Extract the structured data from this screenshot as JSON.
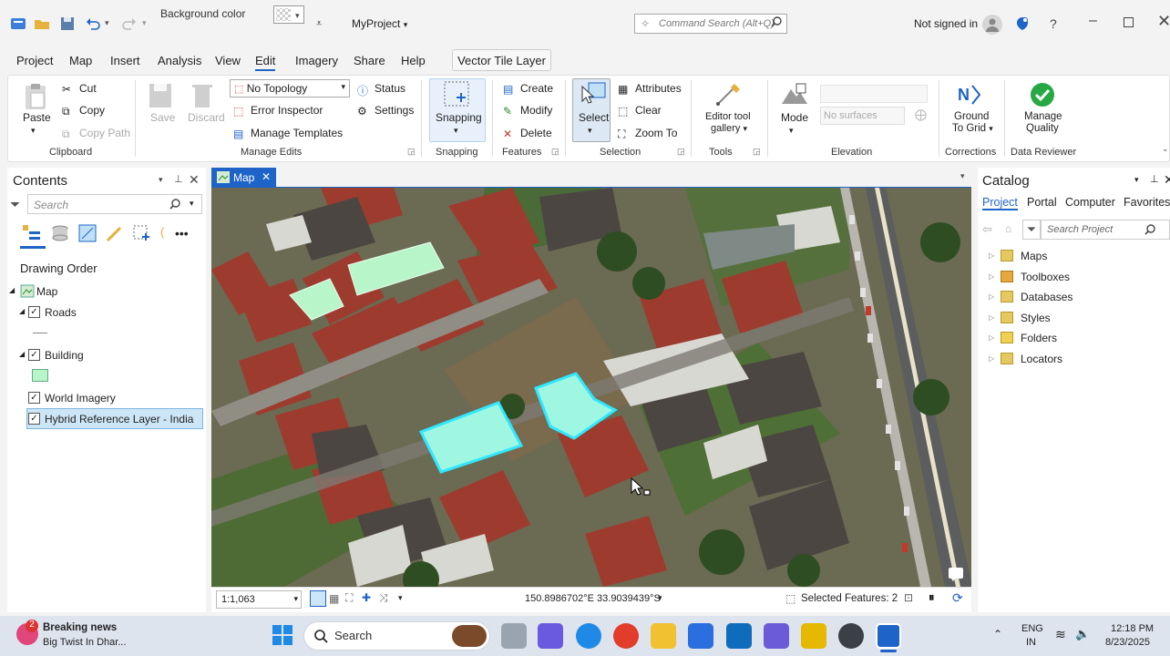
{
  "titlebar": {
    "background_color_label": "Background color",
    "project_name": "MyProject",
    "command_search_placeholder": "Command Search (Alt+Q)",
    "not_signed_in": "Not signed in"
  },
  "menu": [
    "Project",
    "Map",
    "Insert",
    "Analysis",
    "View",
    "Edit",
    "Imagery",
    "Share",
    "Help"
  ],
  "contextual_tab": "Vector Tile Layer",
  "ribbon": {
    "clipboard": {
      "paste": "Paste",
      "cut": "Cut",
      "copy": "Copy",
      "copy_path": "Copy Path",
      "group": "Clipboard"
    },
    "manage_edits": {
      "save": "Save",
      "discard": "Discard",
      "topology": "No Topology",
      "status": "Status",
      "error_inspector": "Error Inspector",
      "settings": "Settings",
      "manage_templates": "Manage Templates",
      "group": "Manage Edits"
    },
    "snapping": {
      "snapping": "Snapping",
      "group": "Snapping"
    },
    "features": {
      "create": "Create",
      "modify": "Modify",
      "delete": "Delete",
      "group": "Features"
    },
    "selection": {
      "select": "Select",
      "attributes": "Attributes",
      "clear": "Clear",
      "zoom_to": "Zoom To",
      "group": "Selection"
    },
    "tools": {
      "editor_tool_gallery_1": "Editor tool",
      "editor_tool_gallery_2": "gallery",
      "group": "Tools"
    },
    "elevation": {
      "mode": "Mode",
      "surfaces": "No surfaces",
      "group": "Elevation"
    },
    "corrections": {
      "ground_1": "Ground",
      "ground_2": "To Grid",
      "group": "Corrections"
    },
    "data_reviewer": {
      "manage_1": "Manage",
      "manage_2": "Quality",
      "group": "Data Reviewer"
    }
  },
  "contents": {
    "title": "Contents",
    "search_placeholder": "Search",
    "drawing_order": "Drawing Order",
    "map_node": "Map",
    "layers": [
      "Roads",
      "Building",
      "World Imagery",
      "Hybrid Reference Layer - India"
    ]
  },
  "map_view": {
    "tab": "Map",
    "scale": "1:1,063",
    "coordinates": "150.8986702°E 33.9039439°S",
    "selected_features": "Selected Features: 2"
  },
  "catalog": {
    "title": "Catalog",
    "tabs": [
      "Project",
      "Portal",
      "Computer",
      "Favorites"
    ],
    "search_placeholder": "Search Project",
    "items": [
      "Maps",
      "Toolboxes",
      "Databases",
      "Styles",
      "Folders",
      "Locators"
    ]
  },
  "taskbar": {
    "news_badge": "2",
    "news_title": "Breaking news",
    "news_subtitle": "Big Twist In Dhar...",
    "search_label": "Search",
    "lang_1": "ENG",
    "lang_2": "IN",
    "time": "12:18 PM",
    "date": "8/23/2025"
  },
  "colors": {
    "accent": "#1e64c8",
    "selection_fill": "#9ff7e2",
    "selection_outline": "#2fe8ff",
    "building_fill": "#b8f5c8"
  }
}
